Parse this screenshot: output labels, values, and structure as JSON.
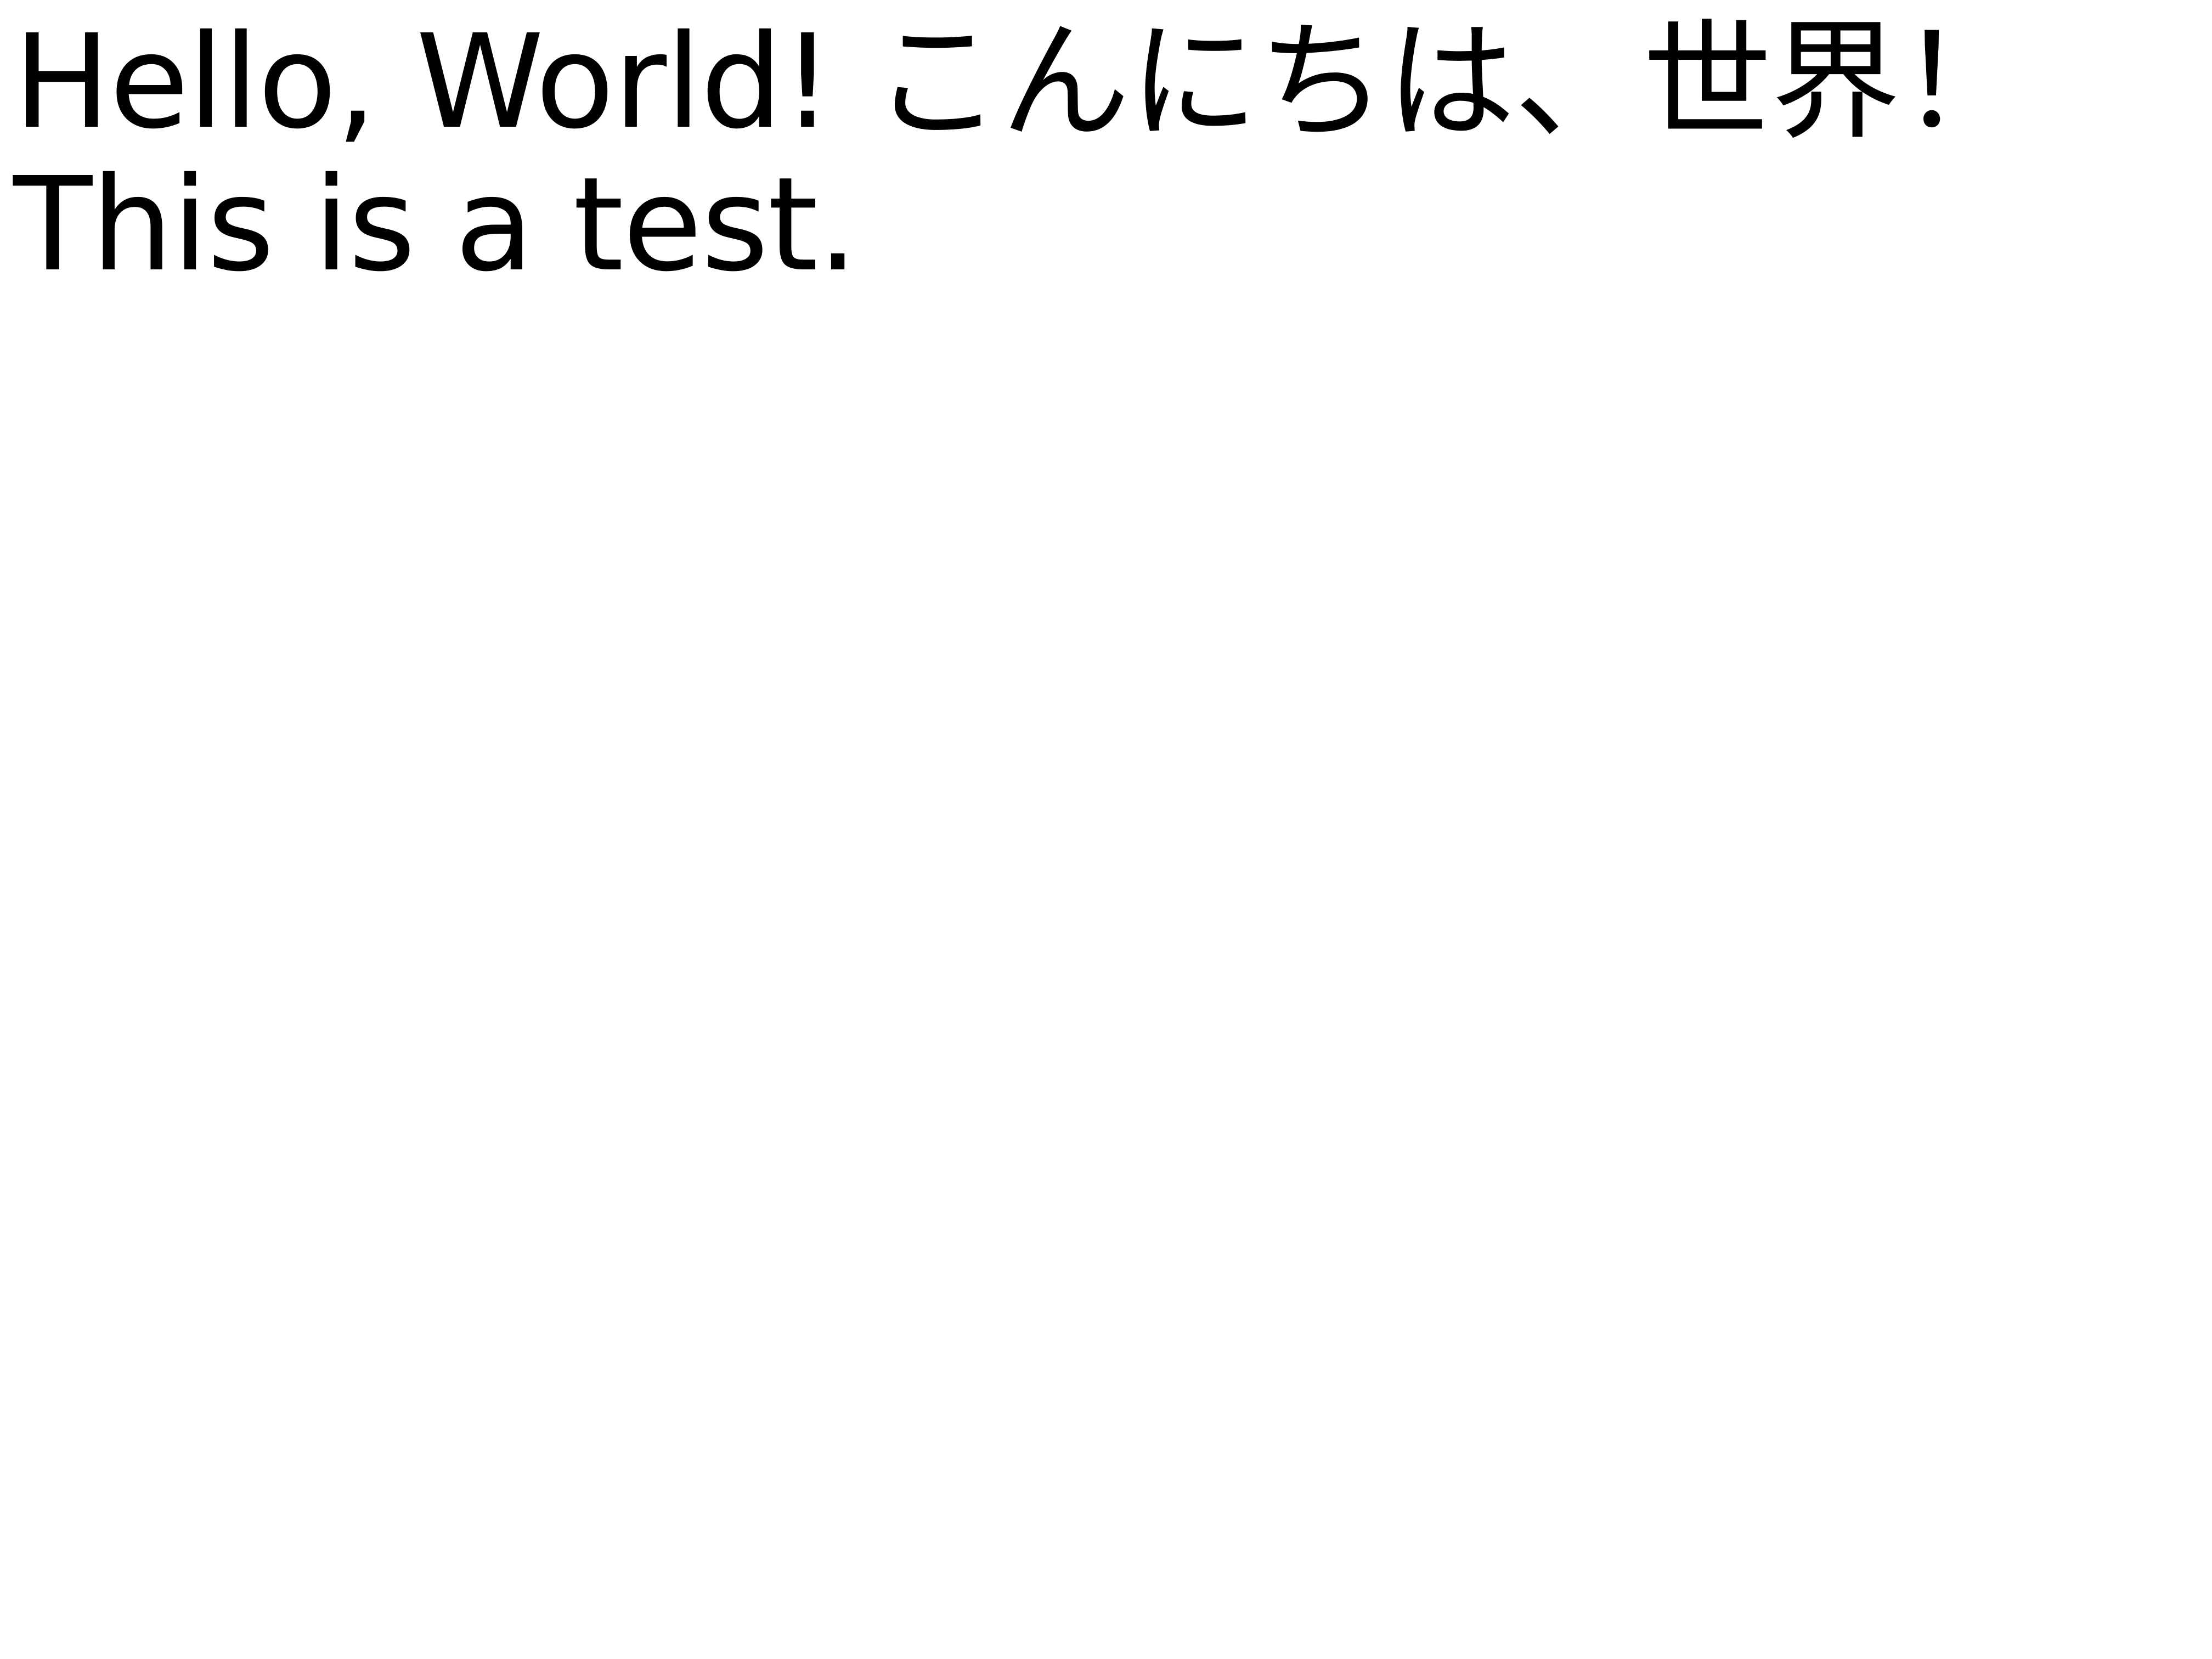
{
  "document": {
    "lines": [
      "Hello, World! こんにちは、世界！",
      "This is a test."
    ]
  },
  "colors": {
    "background": "#ffffff",
    "text": "#000000"
  }
}
